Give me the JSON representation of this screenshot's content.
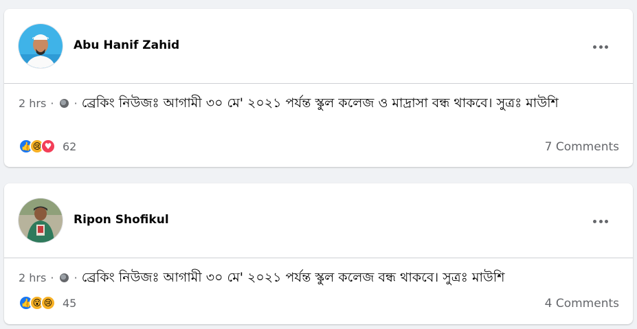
{
  "posts": [
    {
      "author": "Abu Hanif Zahid",
      "time": "2 hrs",
      "sep": "·",
      "text": "ব্রেকিং নিউজঃ আগামী ৩০ মে' ২০২১ পর্যন্ত স্কুল কলেজ ও মাদ্রাসা বন্ধ থাকবে। সুত্রঃ মাউশি",
      "reaction_icons": [
        "like-icon",
        "sad-icon",
        "love-icon"
      ],
      "reaction_count": "62",
      "comments": "7 Comments"
    },
    {
      "author": "Ripon Shofikul",
      "time": "2 hrs",
      "sep": "·",
      "text": "ব্রেকিং নিউজঃ আগামী ৩০ মে' ২০২১ পর্যন্ত স্কুল কলেজ বন্ধ থাকবে। সুত্রঃ মাউশি",
      "reaction_icons": [
        "like-icon",
        "wow-icon",
        "sad-icon"
      ],
      "reaction_count": "45",
      "comments": "4 Comments"
    }
  ]
}
